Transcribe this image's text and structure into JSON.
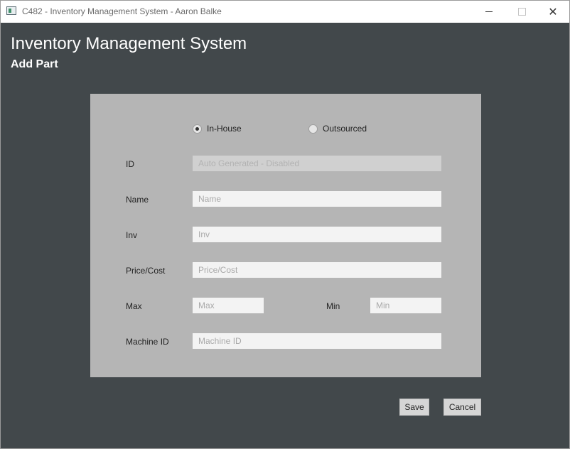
{
  "window": {
    "title": "C482 - Inventory Management System - Aaron Balke"
  },
  "header": {
    "title": "Inventory Management System",
    "subtitle": "Add Part"
  },
  "source_type": {
    "options": [
      {
        "label": "In-House",
        "selected": true
      },
      {
        "label": "Outsourced",
        "selected": false
      }
    ]
  },
  "fields": {
    "id": {
      "label": "ID",
      "placeholder": "Auto Generated - Disabled",
      "value": ""
    },
    "name": {
      "label": "Name",
      "placeholder": "Name",
      "value": ""
    },
    "inv": {
      "label": "Inv",
      "placeholder": "Inv",
      "value": ""
    },
    "price": {
      "label": "Price/Cost",
      "placeholder": "Price/Cost",
      "value": ""
    },
    "max": {
      "label": "Max",
      "placeholder": "Max",
      "value": ""
    },
    "min": {
      "label": "Min",
      "placeholder": "Min",
      "value": ""
    },
    "machine_id": {
      "label": "Machine ID",
      "placeholder": "Machine ID",
      "value": ""
    }
  },
  "actions": {
    "save_label": "Save",
    "cancel_label": "Cancel"
  },
  "colors": {
    "background": "#42484b",
    "panel": "#b5b5b5",
    "input": "#f3f3f3",
    "input_disabled": "#d0d0d0"
  },
  "icons": {
    "app": "app-window-icon",
    "minimize": "minimize-icon",
    "maximize": "maximize-icon",
    "close": "close-icon"
  }
}
